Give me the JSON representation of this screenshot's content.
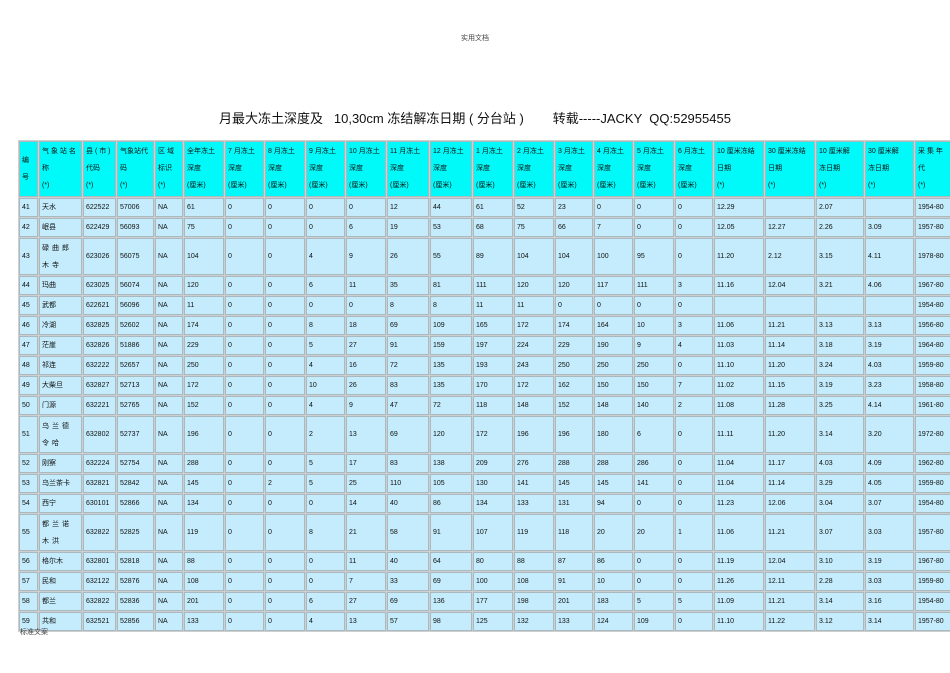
{
  "page_header": "实用文档",
  "page_footer": "标准文案",
  "title": "月最大冻土深度及   10,30cm 冻结解冻日期 ( 分台站 )        转载-----JACKY  QQ:52955455",
  "columns": [
    [
      "编",
      "号"
    ],
    [
      "气 象 站 名",
      "称",
      "(*)"
    ],
    [
      "县 ( 市 )",
      "代码",
      "(*)"
    ],
    [
      "气象站代",
      "码",
      "(*)"
    ],
    [
      "区    域",
      "标识",
      "(*)"
    ],
    [
      "全年冻土",
      "深度",
      "(厘米)"
    ],
    [
      "7 月冻土",
      "深度",
      "(厘米)"
    ],
    [
      "8 月冻土",
      "深度",
      "(厘米)"
    ],
    [
      "9 月冻土",
      "深度",
      "(厘米)"
    ],
    [
      "10 月冻土",
      "深度",
      "(厘米)"
    ],
    [
      "11 月冻土",
      "深度",
      "(厘米)"
    ],
    [
      "12 月冻土",
      "深度",
      "(厘米)"
    ],
    [
      "1 月冻土",
      "深度",
      "(厘米)"
    ],
    [
      "2 月冻土",
      "深度",
      "(厘米)"
    ],
    [
      "3 月冻土",
      "深度",
      "(厘米)"
    ],
    [
      "4 月冻土",
      "深度",
      "(厘米)"
    ],
    [
      "5 月冻土",
      "深度",
      "(厘米)"
    ],
    [
      "6 月冻土",
      "深度",
      "(厘米)"
    ],
    [
      "10 厘米冻结",
      "日期",
      "(*)"
    ],
    [
      "30 厘米冻结",
      "日期",
      "(*)"
    ],
    [
      "10 厘米解",
      "冻日期",
      "(*)"
    ],
    [
      "30 厘米解",
      "冻日期",
      "(*)"
    ],
    [
      "采 集 年",
      "代",
      "(*)"
    ]
  ],
  "rows": [
    [
      "41",
      "天水",
      "622522",
      "57006",
      "NA",
      "61",
      "0",
      "0",
      "0",
      "0",
      "12",
      "44",
      "61",
      "52",
      "23",
      "0",
      "0",
      "0",
      "12.29",
      "",
      "2.07",
      "",
      "1954-80"
    ],
    [
      "42",
      "岷县",
      "622429",
      "56093",
      "NA",
      "75",
      "0",
      "0",
      "0",
      "6",
      "19",
      "53",
      "68",
      "75",
      "66",
      "7",
      "0",
      "0",
      "12.05",
      "12.27",
      "2.26",
      "3.09",
      "1957-80"
    ],
    [
      "43",
      "碌曲郎木寺",
      "623026",
      "56075",
      "NA",
      "104",
      "0",
      "0",
      "4",
      "9",
      "26",
      "55",
      "89",
      "104",
      "104",
      "100",
      "95",
      "0",
      "11.20",
      "2.12",
      "3.15",
      "4.11",
      "1978-80"
    ],
    [
      "44",
      "玛曲",
      "623025",
      "56074",
      "NA",
      "120",
      "0",
      "0",
      "6",
      "11",
      "35",
      "81",
      "111",
      "120",
      "120",
      "117",
      "111",
      "3",
      "11.16",
      "12.04",
      "3.21",
      "4.06",
      "1967-80"
    ],
    [
      "45",
      "武都",
      "622621",
      "56096",
      "NA",
      "11",
      "0",
      "0",
      "0",
      "0",
      "8",
      "8",
      "11",
      "11",
      "0",
      "0",
      "0",
      "0",
      "",
      "",
      "",
      "",
      "1954-80"
    ],
    [
      "46",
      "冷湖",
      "632825",
      "52602",
      "NA",
      "174",
      "0",
      "0",
      "8",
      "18",
      "69",
      "109",
      "165",
      "172",
      "174",
      "164",
      "10",
      "3",
      "11.06",
      "11.21",
      "3.13",
      "3.13",
      "1956-80"
    ],
    [
      "47",
      "茫崖",
      "632826",
      "51886",
      "NA",
      "229",
      "0",
      "0",
      "5",
      "27",
      "91",
      "159",
      "197",
      "224",
      "229",
      "190",
      "9",
      "4",
      "11.03",
      "11.14",
      "3.18",
      "3.19",
      "1964-80"
    ],
    [
      "48",
      "祁连",
      "632222",
      "52657",
      "NA",
      "250",
      "0",
      "0",
      "4",
      "16",
      "72",
      "135",
      "193",
      "243",
      "250",
      "250",
      "250",
      "0",
      "11.10",
      "11.20",
      "3.24",
      "4.03",
      "1959-80"
    ],
    [
      "49",
      "大柴旦",
      "632827",
      "52713",
      "NA",
      "172",
      "0",
      "0",
      "10",
      "26",
      "83",
      "135",
      "170",
      "172",
      "162",
      "150",
      "150",
      "7",
      "11.02",
      "11.15",
      "3.19",
      "3.23",
      "1958-80"
    ],
    [
      "50",
      "门源",
      "632221",
      "52765",
      "NA",
      "152",
      "0",
      "0",
      "4",
      "9",
      "47",
      "72",
      "118",
      "148",
      "152",
      "148",
      "140",
      "2",
      "11.08",
      "11.28",
      "3.25",
      "4.14",
      "1961-80"
    ],
    [
      "51",
      "乌兰德令哈",
      "632802",
      "52737",
      "NA",
      "196",
      "0",
      "0",
      "2",
      "13",
      "69",
      "120",
      "172",
      "196",
      "196",
      "180",
      "6",
      "0",
      "11.11",
      "11.20",
      "3.14",
      "3.20",
      "1972-80"
    ],
    [
      "52",
      "刚察",
      "632224",
      "52754",
      "NA",
      "288",
      "0",
      "0",
      "5",
      "17",
      "83",
      "138",
      "209",
      "276",
      "288",
      "288",
      "286",
      "0",
      "11.04",
      "11.17",
      "4.03",
      "4.09",
      "1962-80"
    ],
    [
      "53",
      "乌兰茶卡",
      "632821",
      "52842",
      "NA",
      "145",
      "0",
      "2",
      "5",
      "25",
      "110",
      "105",
      "130",
      "141",
      "145",
      "145",
      "141",
      "0",
      "11.04",
      "11.14",
      "3.29",
      "4.05",
      "1959-80"
    ],
    [
      "54",
      "西宁",
      "630101",
      "52866",
      "NA",
      "134",
      "0",
      "0",
      "0",
      "14",
      "40",
      "86",
      "134",
      "133",
      "131",
      "94",
      "0",
      "0",
      "11.23",
      "12.06",
      "3.04",
      "3.07",
      "1954-80"
    ],
    [
      "55",
      "都兰诺木洪",
      "632822",
      "52825",
      "NA",
      "119",
      "0",
      "0",
      "8",
      "21",
      "58",
      "91",
      "107",
      "119",
      "118",
      "20",
      "20",
      "1",
      "11.06",
      "11.21",
      "3.07",
      "3.03",
      "1957-80"
    ],
    [
      "56",
      "格尔木",
      "632801",
      "52818",
      "NA",
      "88",
      "0",
      "0",
      "0",
      "11",
      "40",
      "64",
      "80",
      "88",
      "87",
      "86",
      "0",
      "0",
      "11.19",
      "12.04",
      "3.10",
      "3.19",
      "1967-80"
    ],
    [
      "57",
      "民和",
      "632122",
      "52876",
      "NA",
      "108",
      "0",
      "0",
      "0",
      "7",
      "33",
      "69",
      "100",
      "108",
      "91",
      "10",
      "0",
      "0",
      "11.26",
      "12.11",
      "2.28",
      "3.03",
      "1959-80"
    ],
    [
      "58",
      "都兰",
      "632822",
      "52836",
      "NA",
      "201",
      "0",
      "0",
      "6",
      "27",
      "69",
      "136",
      "177",
      "198",
      "201",
      "183",
      "5",
      "5",
      "11.09",
      "11.21",
      "3.14",
      "3.16",
      "1954-80"
    ],
    [
      "59",
      "共和",
      "632521",
      "52856",
      "NA",
      "133",
      "0",
      "0",
      "4",
      "13",
      "57",
      "98",
      "125",
      "132",
      "133",
      "124",
      "109",
      "0",
      "11.10",
      "11.22",
      "3.12",
      "3.14",
      "1957-80"
    ]
  ]
}
